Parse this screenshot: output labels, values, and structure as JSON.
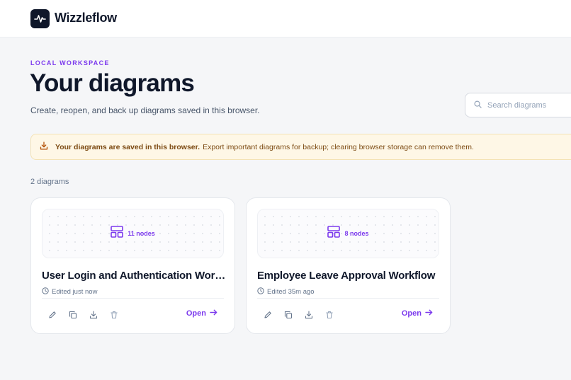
{
  "app": {
    "name": "Wizzleflow",
    "accent": "#7c3aed"
  },
  "header": {
    "eyebrow": "LOCAL WORKSPACE",
    "title": "Your diagrams",
    "subtitle": "Create, reopen, and back up diagrams saved in this browser."
  },
  "search": {
    "placeholder": "Search diagrams",
    "value": ""
  },
  "notice": {
    "icon": "download-icon",
    "strong": "Your diagrams are saved in this browser.",
    "text": "Export important diagrams for backup; clearing browser storage can remove them."
  },
  "diagram_count": "2 diagrams",
  "diagrams": [
    {
      "title": "User Login and Authentication Work...",
      "nodes": "11 nodes",
      "edited": "Edited just now",
      "open_label": "Open"
    },
    {
      "title": "Employee Leave Approval Workflow",
      "nodes": "8 nodes",
      "edited": "Edited 35m ago",
      "open_label": "Open"
    }
  ],
  "card_actions": [
    "edit-icon",
    "duplicate-icon",
    "download-icon",
    "trash-icon"
  ]
}
